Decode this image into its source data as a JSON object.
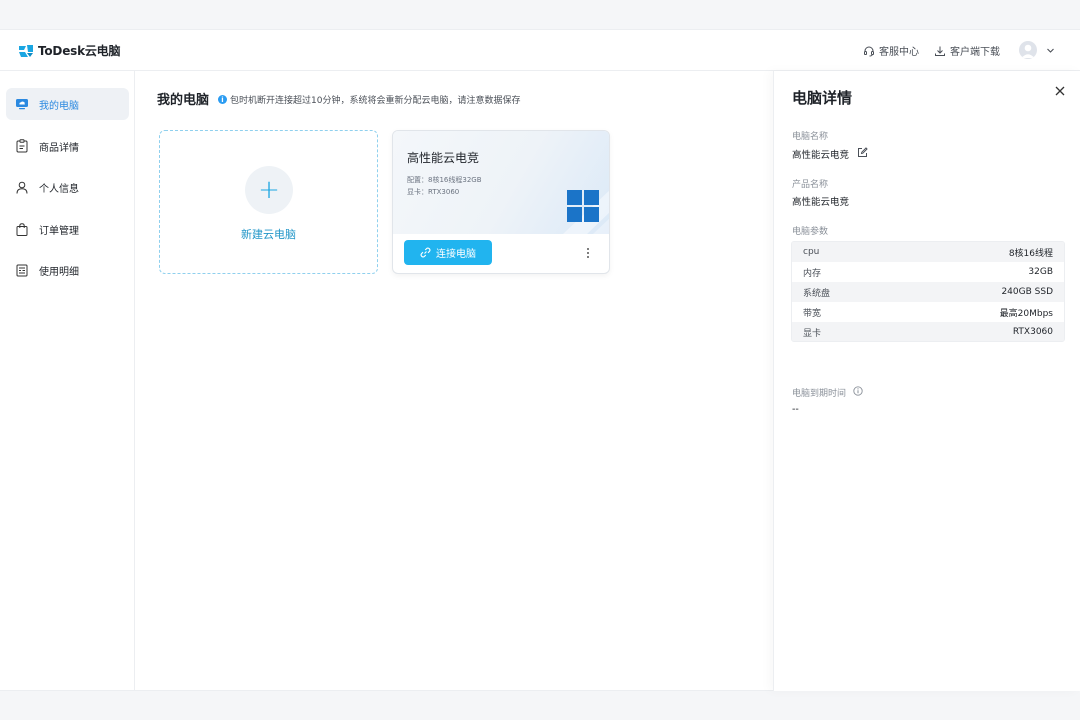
{
  "app": {
    "title": "ToDesk云电脑"
  },
  "header": {
    "support_label": "客服中心",
    "download_label": "客户端下载",
    "icons": [
      "headset-icon",
      "download-icon",
      "user-avatar-icon",
      "chevron-down-icon"
    ]
  },
  "sidebar": {
    "items": [
      {
        "label": "我的电脑",
        "icon": "cloud-monitor-icon",
        "active": true
      },
      {
        "label": "商品详情",
        "icon": "clipboard-icon",
        "active": false
      },
      {
        "label": "个人信息",
        "icon": "person-icon",
        "active": false
      },
      {
        "label": "订单管理",
        "icon": "shopping-bag-icon",
        "active": false
      },
      {
        "label": "使用明细",
        "icon": "list-detail-icon",
        "active": false
      }
    ]
  },
  "main": {
    "title": "我的电脑",
    "notice": "包时机断开连接超过10分钟，系统将会重新分配云电脑，请注意数据保存",
    "new_card_label": "新建云电脑",
    "pc_card": {
      "name": "高性能云电竞",
      "config": "配置：8核16线程32GB",
      "gpu": "显卡：RTX3060",
      "connect_label": "连接电脑"
    }
  },
  "detail": {
    "title": "电脑详情",
    "pc_name_label": "电脑名称",
    "pc_name_value": "高性能云电竞",
    "product_label": "产品名称",
    "product_value": "高性能云电竞",
    "params_label": "电脑参数",
    "params": [
      {
        "key": "cpu",
        "value": "8核16线程"
      },
      {
        "key": "内存",
        "value": "32GB"
      },
      {
        "key": "系统盘",
        "value": "240GB SSD"
      },
      {
        "key": "带宽",
        "value": "最高20Mbps"
      },
      {
        "key": "显卡",
        "value": "RTX3060"
      }
    ],
    "expire_label": "电脑到期时间",
    "expire_value": "--"
  },
  "colors": {
    "accent": "#21b4ef",
    "active_text": "#2b89e0",
    "windows_blue": "#1b74c8"
  }
}
